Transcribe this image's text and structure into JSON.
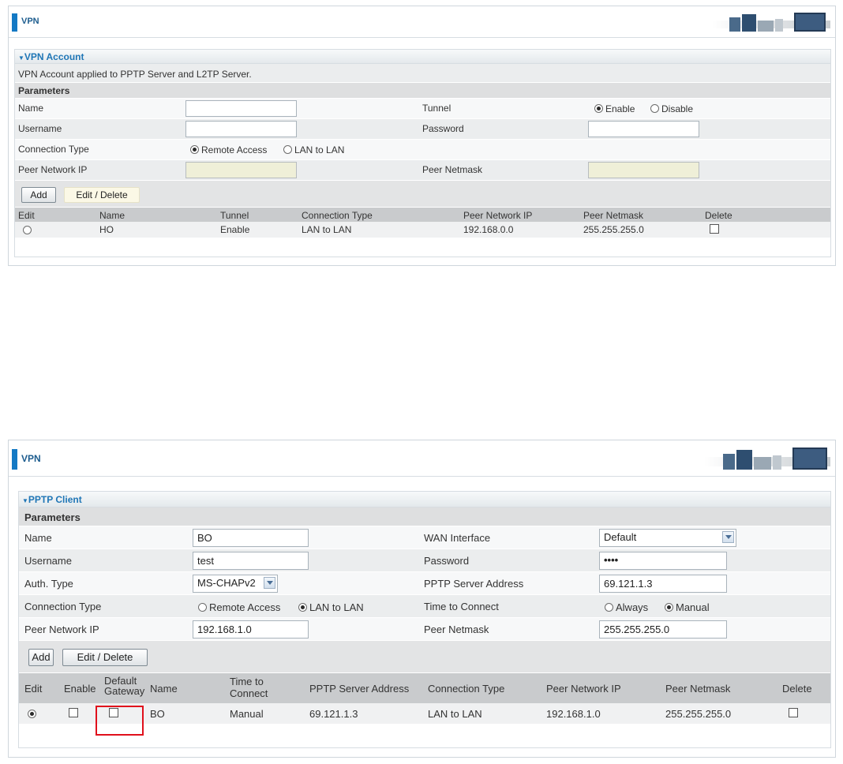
{
  "panel1": {
    "title": "VPN",
    "section_title": "VPN Account",
    "description": "VPN Account applied to PPTP Server and L2TP Server.",
    "params_header": "Parameters",
    "name_label": "Name",
    "name_value": "",
    "tunnel_label": "Tunnel",
    "tunnel_enable": "Enable",
    "tunnel_disable": "Disable",
    "tunnel_selected": "Enable",
    "username_label": "Username",
    "username_value": "",
    "password_label": "Password",
    "password_value": "",
    "conn_type_label": "Connection Type",
    "conn_remote": "Remote Access",
    "conn_lan": "LAN to LAN",
    "conn_selected": "Remote Access",
    "peer_ip_label": "Peer Network IP",
    "peer_netmask_label": "Peer Netmask",
    "add_label": "Add",
    "edit_delete_label": "Edit / Delete",
    "table": {
      "headers": [
        "Edit",
        "Name",
        "Tunnel",
        "Connection Type",
        "Peer Network IP",
        "Peer Netmask",
        "Delete"
      ],
      "rows": [
        {
          "name": "HO",
          "tunnel": "Enable",
          "conn_type": "LAN to LAN",
          "peer_ip": "192.168.0.0",
          "peer_netmask": "255.255.255.0"
        }
      ]
    }
  },
  "panel2": {
    "title": "VPN",
    "section_title": "PPTP Client",
    "params_header": "Parameters",
    "name_label": "Name",
    "name_value": "BO",
    "wan_label": "WAN Interface",
    "wan_value": "Default",
    "username_label": "Username",
    "username_value": "test",
    "password_label": "Password",
    "password_value": "••••",
    "auth_label": "Auth. Type",
    "auth_value": "MS-CHAPv2",
    "server_label": "PPTP Server Address",
    "server_value": "69.121.1.3",
    "conn_type_label": "Connection Type",
    "conn_remote": "Remote Access",
    "conn_lan": "LAN to LAN",
    "conn_selected": "LAN to LAN",
    "time_label": "Time to Connect",
    "time_always": "Always",
    "time_manual": "Manual",
    "time_selected": "Manual",
    "peer_ip_label": "Peer Network IP",
    "peer_ip_value": "192.168.1.0",
    "peer_netmask_label": "Peer Netmask",
    "peer_netmask_value": "255.255.255.0",
    "add_label": "Add",
    "edit_delete_label": "Edit / Delete",
    "table": {
      "headers": {
        "edit": "Edit",
        "enable": "Enable",
        "default_gw_1": "Default",
        "default_gw_2": "Gateway",
        "name": "Name",
        "time_1": "Time to",
        "time_2": "Connect",
        "server": "PPTP Server Address",
        "conn_type": "Connection Type",
        "peer_ip": "Peer Network IP",
        "peer_netmask": "Peer Netmask",
        "delete": "Delete"
      },
      "rows": [
        {
          "name": "BO",
          "time": "Manual",
          "server": "69.121.1.3",
          "conn_type": "LAN to LAN",
          "peer_ip": "192.168.1.0",
          "peer_netmask": "255.255.255.0"
        }
      ]
    }
  },
  "colors": {
    "accent_blue": "#1479c4",
    "section_title_blue": "#1f76b6",
    "highlight_red": "#e0101c"
  }
}
